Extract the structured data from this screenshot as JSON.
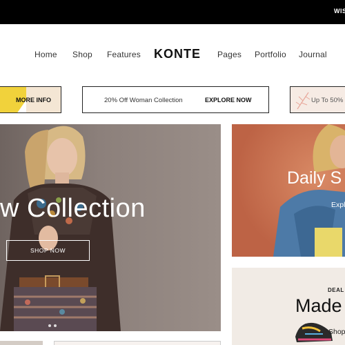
{
  "topbar": {
    "text": "WISH"
  },
  "nav": {
    "logo": "KONTE",
    "items": [
      "Home",
      "Shop",
      "Features",
      "Pages",
      "Portfolio",
      "Journal"
    ]
  },
  "promos": {
    "left": {
      "label": "MORE INFO"
    },
    "middle": {
      "text": "20% Off Woman Collection",
      "cta": "EXPLORE NOW"
    },
    "right": {
      "text": "Up To 50%"
    }
  },
  "hero": {
    "title": "w Collection",
    "button": "SHOP NOW",
    "dots": 2
  },
  "banner1": {
    "title": "Daily S",
    "link": "Explo"
  },
  "banner2": {
    "eyebrow": "DEAL O",
    "title": "Made",
    "link": "Shop"
  },
  "colors": {
    "topbar": "#000000",
    "promo_yellow": "#f1d23b",
    "banner_orange": "#c4704f",
    "banner_cream": "#f1ebe5"
  }
}
